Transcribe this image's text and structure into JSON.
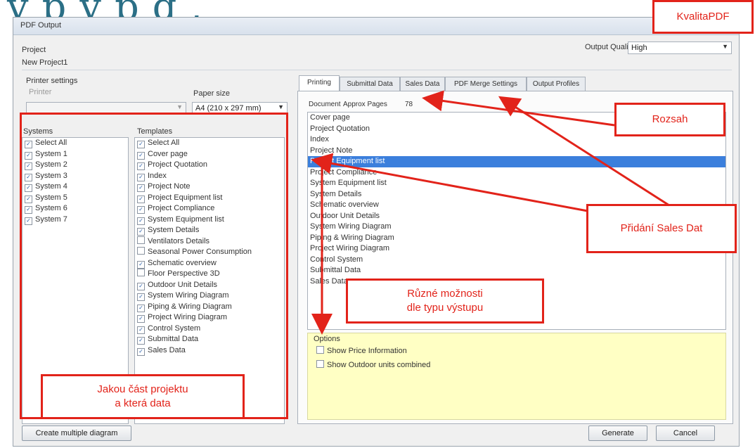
{
  "heading_fragment": "y    p y p  g                ,",
  "window": {
    "title": "PDF Output"
  },
  "project": {
    "label": "Project",
    "name": "New Project1",
    "output_quality_label": "Output Quality",
    "output_quality_value": "High"
  },
  "printer": {
    "group_label": "Printer settings",
    "printer_label": "Printer",
    "paper_size_label": "Paper size",
    "paper_size_value": "A4 (210 x 297 mm)"
  },
  "systems": {
    "header": "Systems",
    "items": [
      "Select All",
      "System 1",
      "System 2",
      "System 3",
      "System 4",
      "System 5",
      "System 6",
      "System 7"
    ]
  },
  "templates": {
    "header": "Templates",
    "items": [
      {
        "label": "Select All",
        "checked": true
      },
      {
        "label": "Cover page",
        "checked": true
      },
      {
        "label": "Project Quotation",
        "checked": true
      },
      {
        "label": "Index",
        "checked": true
      },
      {
        "label": "Project Note",
        "checked": true
      },
      {
        "label": "Project Equipment list",
        "checked": true
      },
      {
        "label": "Project Compliance",
        "checked": true
      },
      {
        "label": "System Equipment list",
        "checked": true
      },
      {
        "label": "System Details",
        "checked": true
      },
      {
        "label": "Ventilators Details",
        "checked": false
      },
      {
        "label": "Seasonal Power Consumption",
        "checked": false
      },
      {
        "label": "Schematic overview",
        "checked": true
      },
      {
        "label": "Floor Perspective 3D",
        "checked": false
      },
      {
        "label": "Outdoor Unit Details",
        "checked": true
      },
      {
        "label": "System Wiring Diagram",
        "checked": true
      },
      {
        "label": "Piping & Wiring Diagram",
        "checked": true
      },
      {
        "label": "Project Wiring Diagram",
        "checked": true
      },
      {
        "label": "Control System",
        "checked": true
      },
      {
        "label": "Submittal Data",
        "checked": true
      },
      {
        "label": "Sales Data",
        "checked": true
      }
    ]
  },
  "tabs": [
    "Printing",
    "Submittal Data",
    "Sales Data",
    "PDF Merge Settings",
    "Output Profiles"
  ],
  "document_bar": {
    "document": "Document",
    "approx_pages": "Approx Pages",
    "pages_value": "78"
  },
  "document_list": {
    "items": [
      "Cover page",
      "Project Quotation",
      "Index",
      "Project Note",
      "Project Equipment list",
      "Project Compliance",
      "System Equipment list",
      "System Details",
      "Schematic overview",
      "Outdoor Unit Details",
      "System Wiring Diagram",
      "Piping & Wiring Diagram",
      "Project Wiring Diagram",
      "Control System",
      "Submittal Data",
      "Sales Data"
    ],
    "selected_index": 4
  },
  "options": {
    "label": "Options",
    "show_price": "Show Price Information",
    "show_outdoor": "Show Outdoor units combined"
  },
  "buttons": {
    "create_multiple": "Create multiple diagram",
    "generate": "Generate",
    "cancel": "Cancel"
  },
  "annotations": {
    "kvalita": "KvalitaPDF",
    "rozsah": "Rozsah",
    "sales": "Přidání Sales Dat",
    "moznosti_line1": "Různé možnosti",
    "moznosti_line2": "dle typu výstupu",
    "jakou_line1": "Jakou část projektu",
    "jakou_line2": "a která data"
  },
  "colors": {
    "annotation_red": "#e2231a",
    "selection_blue": "#3b7fdc",
    "options_bg": "#ffffc4",
    "heading_teal": "#2b6f86"
  }
}
